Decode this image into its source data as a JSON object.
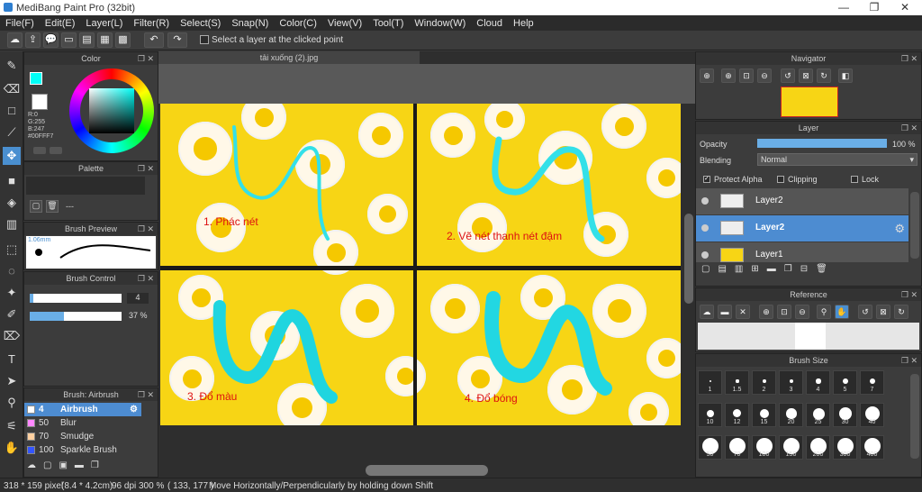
{
  "window": {
    "title": "MediBang Paint Pro (32bit)",
    "min": "—",
    "restore": "❐",
    "close": "✕"
  },
  "menu": [
    "File(F)",
    "Edit(E)",
    "Layer(L)",
    "Filter(R)",
    "Select(S)",
    "Snap(N)",
    "Color(C)",
    "View(V)",
    "Tool(T)",
    "Window(W)",
    "Cloud",
    "Help"
  ],
  "toolbar": {
    "select_layer_label": "Select a layer at the clicked point"
  },
  "color_panel": {
    "title": "Color",
    "r": "R:0",
    "g": "G:255",
    "b": "B:247",
    "hex": "#00FFF7",
    "fg": "#00FFF7",
    "bg": "#FFFFFF"
  },
  "palette_panel": {
    "title": "Palette",
    "dash": "---"
  },
  "brush_preview": {
    "title": "Brush Preview",
    "size": "1.06mm"
  },
  "brush_control": {
    "title": "Brush Control",
    "size_value": "4",
    "opacity_value": "37 %",
    "opacity_fraction": 0.37,
    "size_fraction": 0.04
  },
  "brush_list": {
    "title": "Brush: Airbrush",
    "items": [
      {
        "size": "4",
        "name": "Airbrush",
        "color": "#ffffff",
        "selected": true
      },
      {
        "size": "50",
        "name": "Blur",
        "color": "#ff88ff",
        "selected": false
      },
      {
        "size": "70",
        "name": "Smudge",
        "color": "#ffd0a0",
        "selected": false
      },
      {
        "size": "100",
        "name": "Sparkle Brush",
        "color": "#3355ff",
        "selected": false
      }
    ]
  },
  "document": {
    "tab": "tải xuống (2).jpg"
  },
  "canvas_labels": [
    "1. Phác nét",
    "2. Vẽ nét thanh nét đậm",
    "3. Đổ màu",
    "4. Đổ bóng"
  ],
  "navigator": {
    "title": "Navigator"
  },
  "layer_panel": {
    "title": "Layer",
    "opacity_label": "Opacity",
    "opacity_value": "100 %",
    "blending_label": "Blending",
    "blending_value": "Normal",
    "protect_alpha": "Protect Alpha",
    "clipping": "Clipping",
    "lock": "Lock",
    "layers": [
      {
        "name": "Layer2",
        "selected": false
      },
      {
        "name": "Layer2",
        "selected": true
      },
      {
        "name": "Layer1",
        "selected": false
      }
    ]
  },
  "reference": {
    "title": "Reference"
  },
  "brush_size": {
    "title": "Brush Size",
    "sizes": [
      "1",
      "1.5",
      "2",
      "3",
      "4",
      "5",
      "7",
      "10",
      "12",
      "15",
      "20",
      "25",
      "30",
      "40",
      "50",
      "70",
      "100",
      "150",
      "200",
      "300",
      "400"
    ]
  },
  "status": {
    "dimensions": "318 * 159 pixel",
    "cm": "(8.4 * 4.2cm)",
    "dpi": "96 dpi",
    "zoom": "300 %",
    "coords": "( 133, 177 )",
    "hint": "Move Horizontally/Perpendicularly by holding down Shift"
  },
  "colors": {
    "accent": "#4d8cd1",
    "canvas_bg": "#f7d515",
    "stroke": "#33e0e8"
  }
}
